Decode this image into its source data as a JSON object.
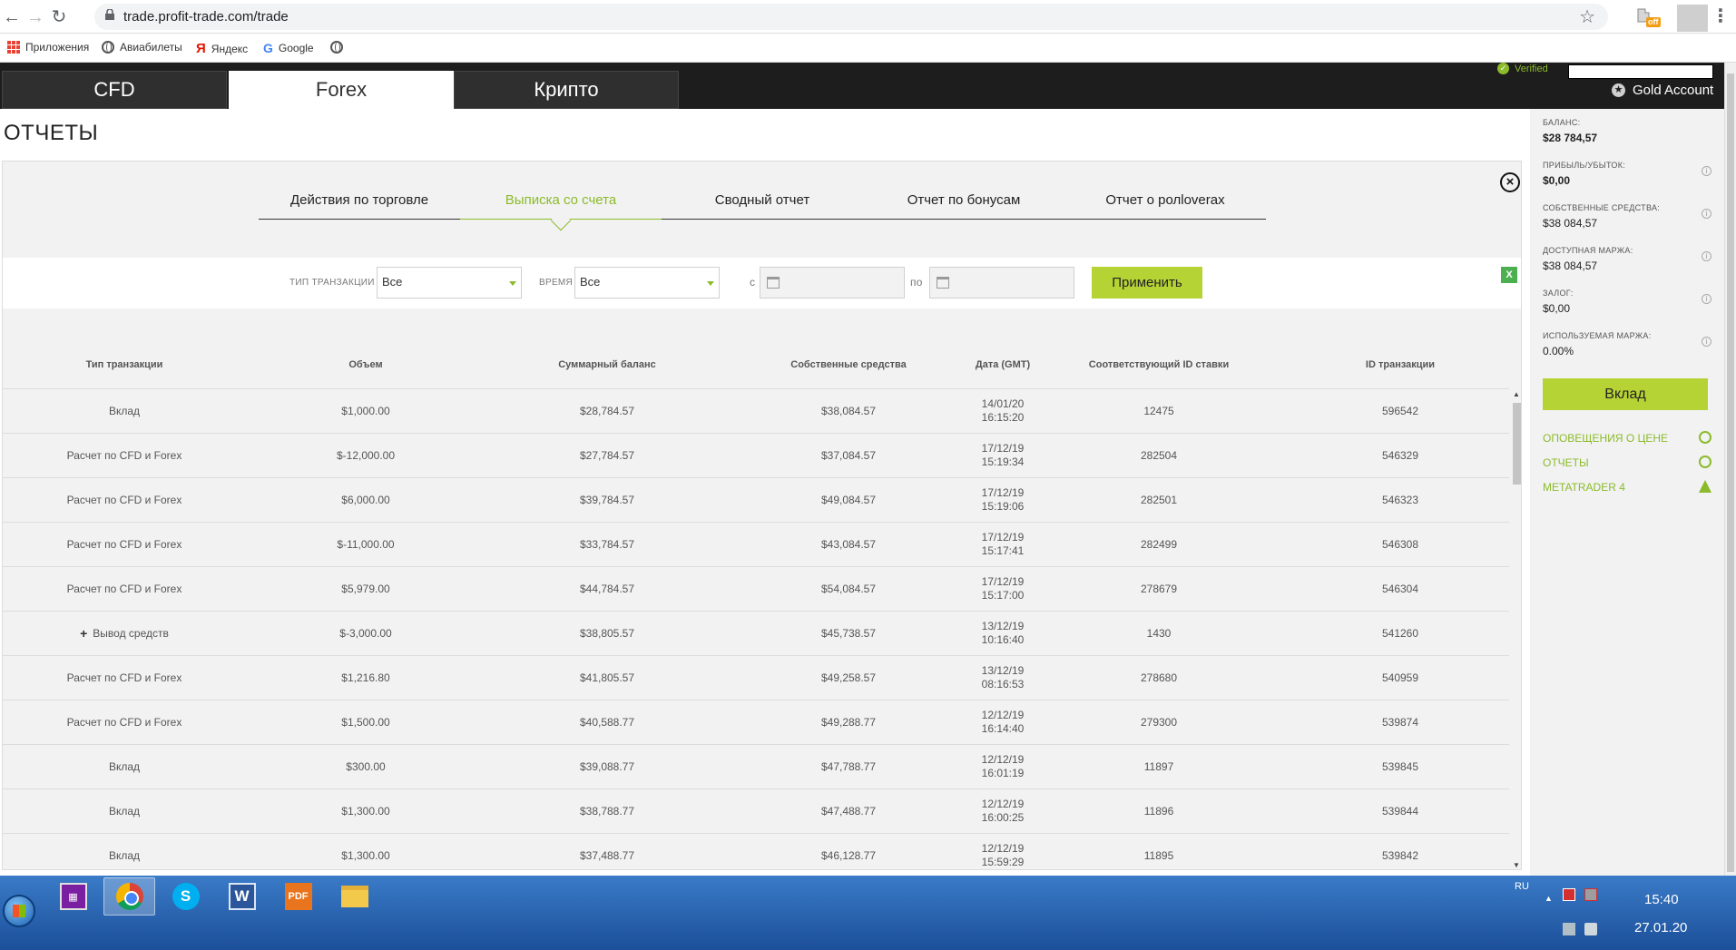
{
  "browser": {
    "url": "trade.profit-trade.com/trade",
    "bookmarks": [
      "Приложения",
      "Авиабилеты",
      "Яндекс",
      "Google"
    ],
    "extension_badge": "off"
  },
  "header": {
    "tabs": [
      "CFD",
      "Forex",
      "Крипто"
    ],
    "active_tab": "Forex",
    "verified": "Verified",
    "account_type": "Gold Account"
  },
  "page_title": "ОТЧЕТЫ",
  "report_tabs": [
    "Действия по торговле",
    "Выписка со счета",
    "Сводный отчет",
    "Отчет по бонусам",
    "Отчет о ролloverах"
  ],
  "filters": {
    "transaction_type_label": "ТИП ТРАНЗАКЦИИ",
    "transaction_type_value": "Все",
    "time_label": "ВРЕМЯ",
    "time_value": "Все",
    "from_label": "с",
    "to_label": "по",
    "apply_label": "Применить",
    "export_icon": "X"
  },
  "table": {
    "headers": [
      "Тип транзакции",
      "Объем",
      "Суммарный баланс",
      "Собственные средства",
      "Дата (GMT)",
      "Соответствующий ID ставки",
      "ID транзакции"
    ],
    "rows": [
      {
        "type": "Вклад",
        "expand": "",
        "volume": "$1,000.00",
        "balance": "$28,784.57",
        "equity": "$38,084.57",
        "date": "14/01/20",
        "time": "16:15:20",
        "bet_id": "12475",
        "tx_id": "596542"
      },
      {
        "type": "Расчет по CFD и Forex",
        "expand": "",
        "volume": "$-12,000.00",
        "balance": "$27,784.57",
        "equity": "$37,084.57",
        "date": "17/12/19",
        "time": "15:19:34",
        "bet_id": "282504",
        "tx_id": "546329"
      },
      {
        "type": "Расчет по CFD и Forex",
        "expand": "",
        "volume": "$6,000.00",
        "balance": "$39,784.57",
        "equity": "$49,084.57",
        "date": "17/12/19",
        "time": "15:19:06",
        "bet_id": "282501",
        "tx_id": "546323"
      },
      {
        "type": "Расчет по CFD и Forex",
        "expand": "",
        "volume": "$-11,000.00",
        "balance": "$33,784.57",
        "equity": "$43,084.57",
        "date": "17/12/19",
        "time": "15:17:41",
        "bet_id": "282499",
        "tx_id": "546308"
      },
      {
        "type": "Расчет по CFD и Forex",
        "expand": "",
        "volume": "$5,979.00",
        "balance": "$44,784.57",
        "equity": "$54,084.57",
        "date": "17/12/19",
        "time": "15:17:00",
        "bet_id": "278679",
        "tx_id": "546304"
      },
      {
        "type": "Вывод средств",
        "expand": "+",
        "volume": "$-3,000.00",
        "balance": "$38,805.57",
        "equity": "$45,738.57",
        "date": "13/12/19",
        "time": "10:16:40",
        "bet_id": "1430",
        "tx_id": "541260"
      },
      {
        "type": "Расчет по CFD и Forex",
        "expand": "",
        "volume": "$1,216.80",
        "balance": "$41,805.57",
        "equity": "$49,258.57",
        "date": "13/12/19",
        "time": "08:16:53",
        "bet_id": "278680",
        "tx_id": "540959"
      },
      {
        "type": "Расчет по CFD и Forex",
        "expand": "",
        "volume": "$1,500.00",
        "balance": "$40,588.77",
        "equity": "$49,288.77",
        "date": "12/12/19",
        "time": "16:14:40",
        "bet_id": "279300",
        "tx_id": "539874"
      },
      {
        "type": "Вклад",
        "expand": "",
        "volume": "$300.00",
        "balance": "$39,088.77",
        "equity": "$47,788.77",
        "date": "12/12/19",
        "time": "16:01:19",
        "bet_id": "11897",
        "tx_id": "539845"
      },
      {
        "type": "Вклад",
        "expand": "",
        "volume": "$1,300.00",
        "balance": "$38,788.77",
        "equity": "$47,488.77",
        "date": "12/12/19",
        "time": "16:00:25",
        "bet_id": "11896",
        "tx_id": "539844"
      },
      {
        "type": "Вклад",
        "expand": "",
        "volume": "$1,300.00",
        "balance": "$37,488.77",
        "equity": "$46,128.77",
        "date": "12/12/19",
        "time": "15:59:29",
        "bet_id": "11895",
        "tx_id": "539842"
      }
    ]
  },
  "sidebar": {
    "stats": [
      {
        "label": "БАЛАНС:",
        "value": "$28 784,57",
        "info": false,
        "bold": true
      },
      {
        "label": "ПРИБЫЛЬ/УБЫТОК:",
        "value": "$0,00",
        "info": true,
        "bold": true
      },
      {
        "label": "СОБСТВЕННЫЕ СРЕДСТВА:",
        "value": "$38 084,57",
        "info": true,
        "bold": false
      },
      {
        "label": "ДОСТУПНАЯ МАРЖА:",
        "value": "$38 084,57",
        "info": true,
        "bold": false
      },
      {
        "label": "ЗАЛОГ:",
        "value": "$0,00",
        "info": true,
        "bold": false
      },
      {
        "label": "ИСПОЛЬЗУЕМАЯ МАРЖА:",
        "value": "0.00%",
        "info": true,
        "bold": false
      }
    ],
    "deposit_label": "Вклад",
    "links": [
      "ОПОВЕЩЕНИЯ О ЦЕНЕ",
      "ОТЧЕТЫ",
      "METATRADER 4"
    ]
  },
  "taskbar": {
    "language": "RU",
    "time": "15:40",
    "date": "27.01.20",
    "skype_letter": "S",
    "word_letter": "W",
    "pdf_label": "PDF"
  },
  "colors": {
    "accent": "#8bbb2a",
    "button": "#b5d334",
    "header_bg": "#1d1d1d"
  }
}
